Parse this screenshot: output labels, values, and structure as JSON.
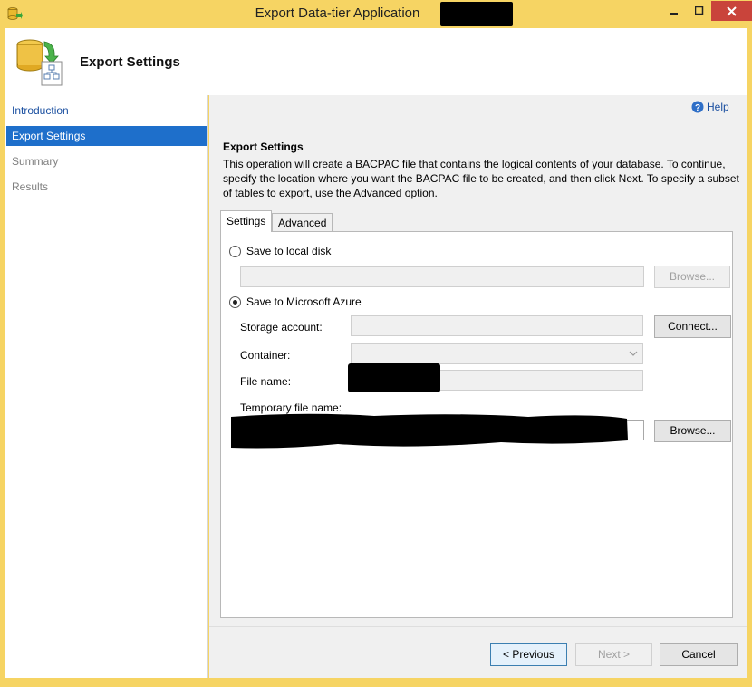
{
  "window": {
    "title": "Export Data-tier Application"
  },
  "header": {
    "title": "Export Settings"
  },
  "sidebar": {
    "items": [
      {
        "label": "Introduction",
        "state": "link"
      },
      {
        "label": "Export Settings",
        "state": "selected"
      },
      {
        "label": "Summary",
        "state": "disabled"
      },
      {
        "label": "Results",
        "state": "disabled"
      }
    ]
  },
  "content": {
    "help_label": "Help",
    "section_title": "Export Settings",
    "description": "This operation will create a BACPAC file that contains the logical contents of your database. To continue, specify the location where you want the BACPAC file to be created, and then click Next. To specify a subset of tables to export, use the Advanced option.",
    "tabs": [
      {
        "label": "Settings",
        "active": true
      },
      {
        "label": "Advanced",
        "active": false
      }
    ],
    "local_disk": {
      "label": "Save to local disk",
      "checked": false,
      "path_value": "",
      "browse_label": "Browse..."
    },
    "azure": {
      "label": "Save to Microsoft Azure",
      "checked": true,
      "storage_account_label": "Storage account:",
      "storage_account_value": "",
      "connect_label": "Connect...",
      "container_label": "Container:",
      "container_value": "",
      "file_name_label": "File name:",
      "temp_file_label": "Temporary file name:",
      "browse_label": "Browse..."
    }
  },
  "footer": {
    "previous_label": "< Previous",
    "next_label": "Next >",
    "cancel_label": "Cancel"
  },
  "colors": {
    "frame": "#f6d463",
    "selection": "#1e6fcb",
    "link": "#1a4fa0",
    "close_button": "#c9443b"
  }
}
